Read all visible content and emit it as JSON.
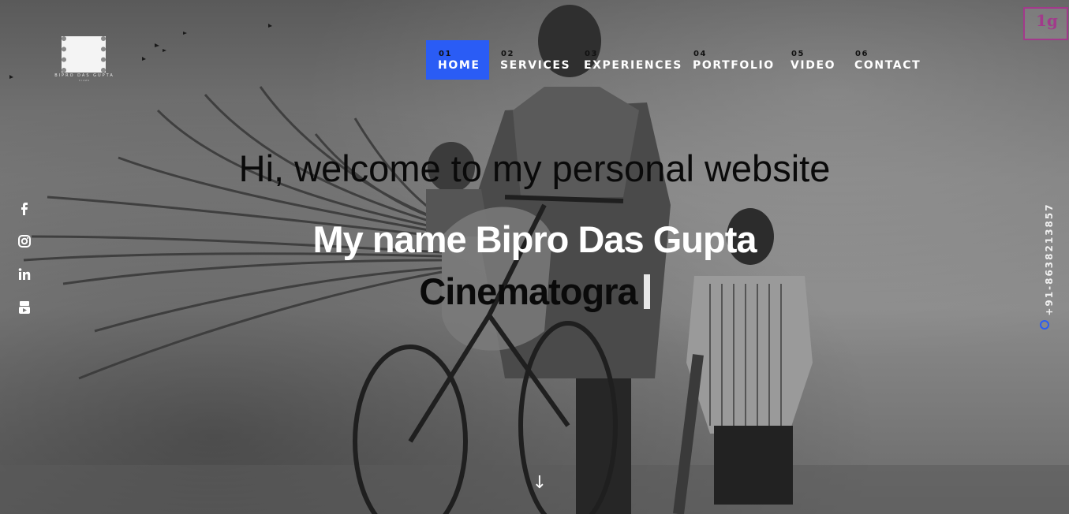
{
  "logo": {
    "text": "BIPRO DAS GUPTA",
    "subtext": "FILMS"
  },
  "nav": {
    "items": [
      {
        "num": "01",
        "label": "HOME",
        "active": true
      },
      {
        "num": "02",
        "label": "SERVICES",
        "active": false
      },
      {
        "num": "03",
        "label": "EXPERIENCES",
        "active": false
      },
      {
        "num": "04",
        "label": "PORTFOLIO",
        "active": false
      },
      {
        "num": "05",
        "label": "VIDEO",
        "active": false
      },
      {
        "num": "06",
        "label": "CONTACT",
        "active": false
      }
    ]
  },
  "social": {
    "icons": [
      "facebook-icon",
      "instagram-icon",
      "linkedin-icon",
      "youtube-icon"
    ]
  },
  "hero": {
    "welcome": "Hi, welcome to my personal website",
    "name": "My name Bipro Das Gupta",
    "typed": "Cinematogra"
  },
  "phone": "+91-8638213857",
  "badge": "1g",
  "colors": {
    "accent": "#2a5cf5",
    "badge": "#a23a8b"
  }
}
